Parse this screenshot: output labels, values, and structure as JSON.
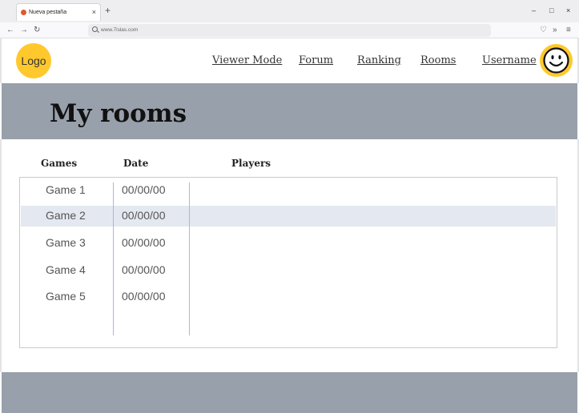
{
  "browser": {
    "tab_title": "Nueva pestaña",
    "tab_close": "×",
    "new_tab": "+",
    "window_controls": {
      "minimize": "–",
      "maximize": "□",
      "close": "×"
    },
    "nav": {
      "back": "←",
      "forward": "→",
      "reload": "↻"
    },
    "url": "www.7islas.com",
    "toolbar": {
      "pocket": "♡",
      "overflow": "»",
      "menu": "≡"
    }
  },
  "header": {
    "logo": "Logo",
    "nav": [
      "Viewer Mode",
      "Forum",
      "Ranking",
      "Rooms",
      "Username"
    ]
  },
  "hero": {
    "title": "My rooms"
  },
  "table": {
    "columns": [
      "Games",
      "Date",
      "Players"
    ],
    "rows": [
      {
        "game": "Game 1",
        "date": "00/00/00"
      },
      {
        "game": "Game 2",
        "date": "00/00/00"
      },
      {
        "game": "Game 3",
        "date": "00/00/00"
      },
      {
        "game": "Game 4",
        "date": "00/00/00"
      },
      {
        "game": "Game 5",
        "date": "00/00/00"
      }
    ]
  },
  "colors": {
    "accent": "#ffc82c",
    "hero_bg": "#98a0ab",
    "row_highlight": "#e4e8f0",
    "column_divider": "#b4b0e6"
  },
  "icons": [
    "firefox-favicon",
    "back-arrow-icon",
    "forward-arrow-icon",
    "reload-icon",
    "search-icon",
    "pocket-icon",
    "overflow-icon",
    "menu-icon",
    "smiley-avatar-icon"
  ]
}
